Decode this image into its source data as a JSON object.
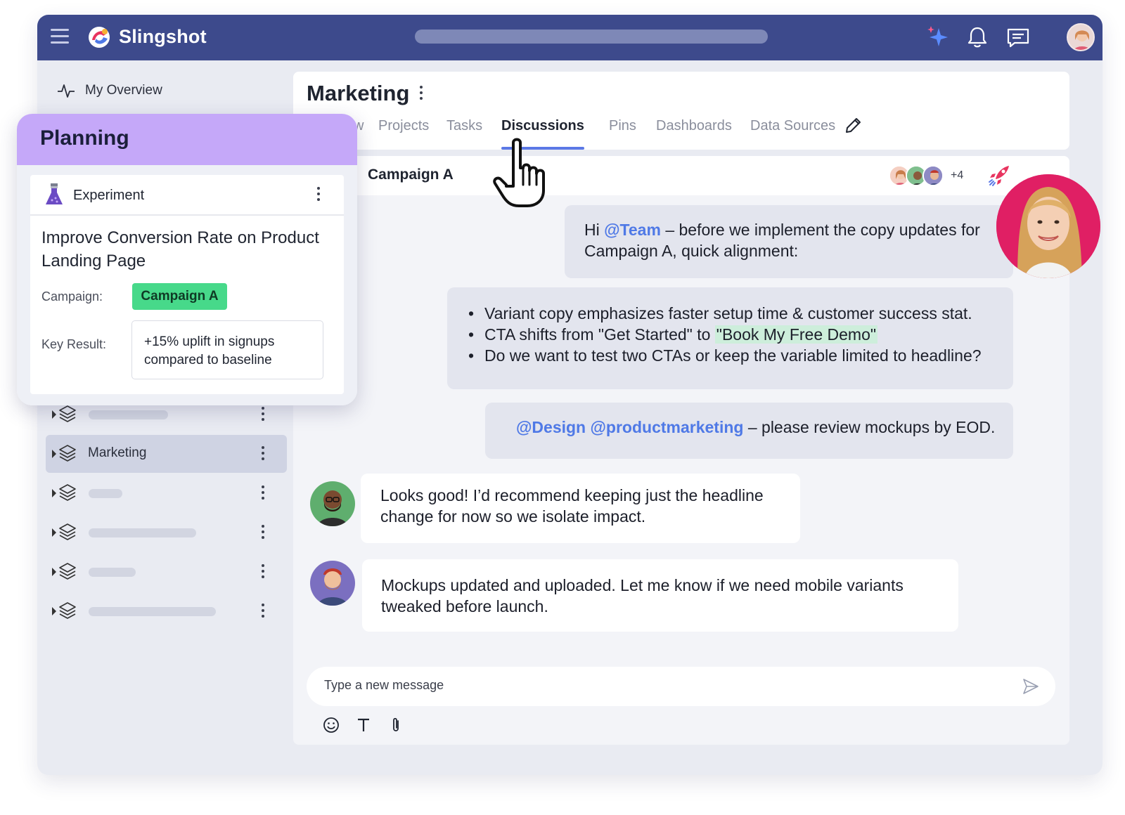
{
  "topbar": {
    "brand": "Slingshot",
    "icons": [
      "menu-icon",
      "sparkle-ai-icon",
      "bell-icon",
      "chat-icon",
      "user-avatar"
    ]
  },
  "sidebar": {
    "overview_label": "My Overview",
    "workspaces": [
      {
        "label": "",
        "active": false
      },
      {
        "label": "Marketing",
        "active": true
      },
      {
        "label": "",
        "active": false
      },
      {
        "label": "",
        "active": false
      },
      {
        "label": "",
        "active": false
      },
      {
        "label": "",
        "active": false
      }
    ]
  },
  "main": {
    "title": "Marketing",
    "tabs": [
      {
        "label": "w",
        "active": false
      },
      {
        "label": "Projects",
        "active": false
      },
      {
        "label": "Tasks",
        "active": false
      },
      {
        "label": "Discussions",
        "active": true
      },
      {
        "label": "Pins",
        "active": false
      },
      {
        "label": "Dashboards",
        "active": false
      },
      {
        "label": "Data Sources",
        "active": false
      }
    ],
    "channel": {
      "name": "Campaign A",
      "more_participants": "+4"
    },
    "messages": {
      "m1": {
        "prefix": "Hi ",
        "mention": "@Team",
        "text": " – before we implement the copy updates for Campaign A, quick alignment:"
      },
      "m2": {
        "b1": "Variant copy emphasizes faster setup time & customer success stat.",
        "b2_pre": "CTA shifts from \"Get Started\" to ",
        "b2_hl": "\"Book My Free Demo\"",
        "b3": "Do we want to test two CTAs or keep the variable limited to headline?"
      },
      "m3": {
        "mention1": "@Design",
        "mention2": "@productmarketing",
        "text": " – please review mockups by EOD."
      },
      "m4": "Looks good! I’d recommend keeping just the headline change for now so we isolate impact.",
      "m5": "Mockups updated and uploaded. Let me know if we need mobile variants tweaked before launch."
    },
    "composer_placeholder": "Type a new message"
  },
  "planning_card": {
    "header": "Planning",
    "type_label": "Experiment",
    "title": "Improve Conversion Rate on Product Landing Page",
    "campaign_label": "Campaign:",
    "campaign_value": "Campaign A",
    "key_result_label": "Key Result:",
    "key_result_value": "+15% uplift in signups compared to baseline"
  },
  "colors": {
    "topbar": "#3d4a8c",
    "accent": "#5b78e6",
    "planning_header": "#c5a8f9",
    "campaign_tag": "#47d98a",
    "highlight": "#cdeedb",
    "floating_avatar_bg": "#e01f64"
  }
}
